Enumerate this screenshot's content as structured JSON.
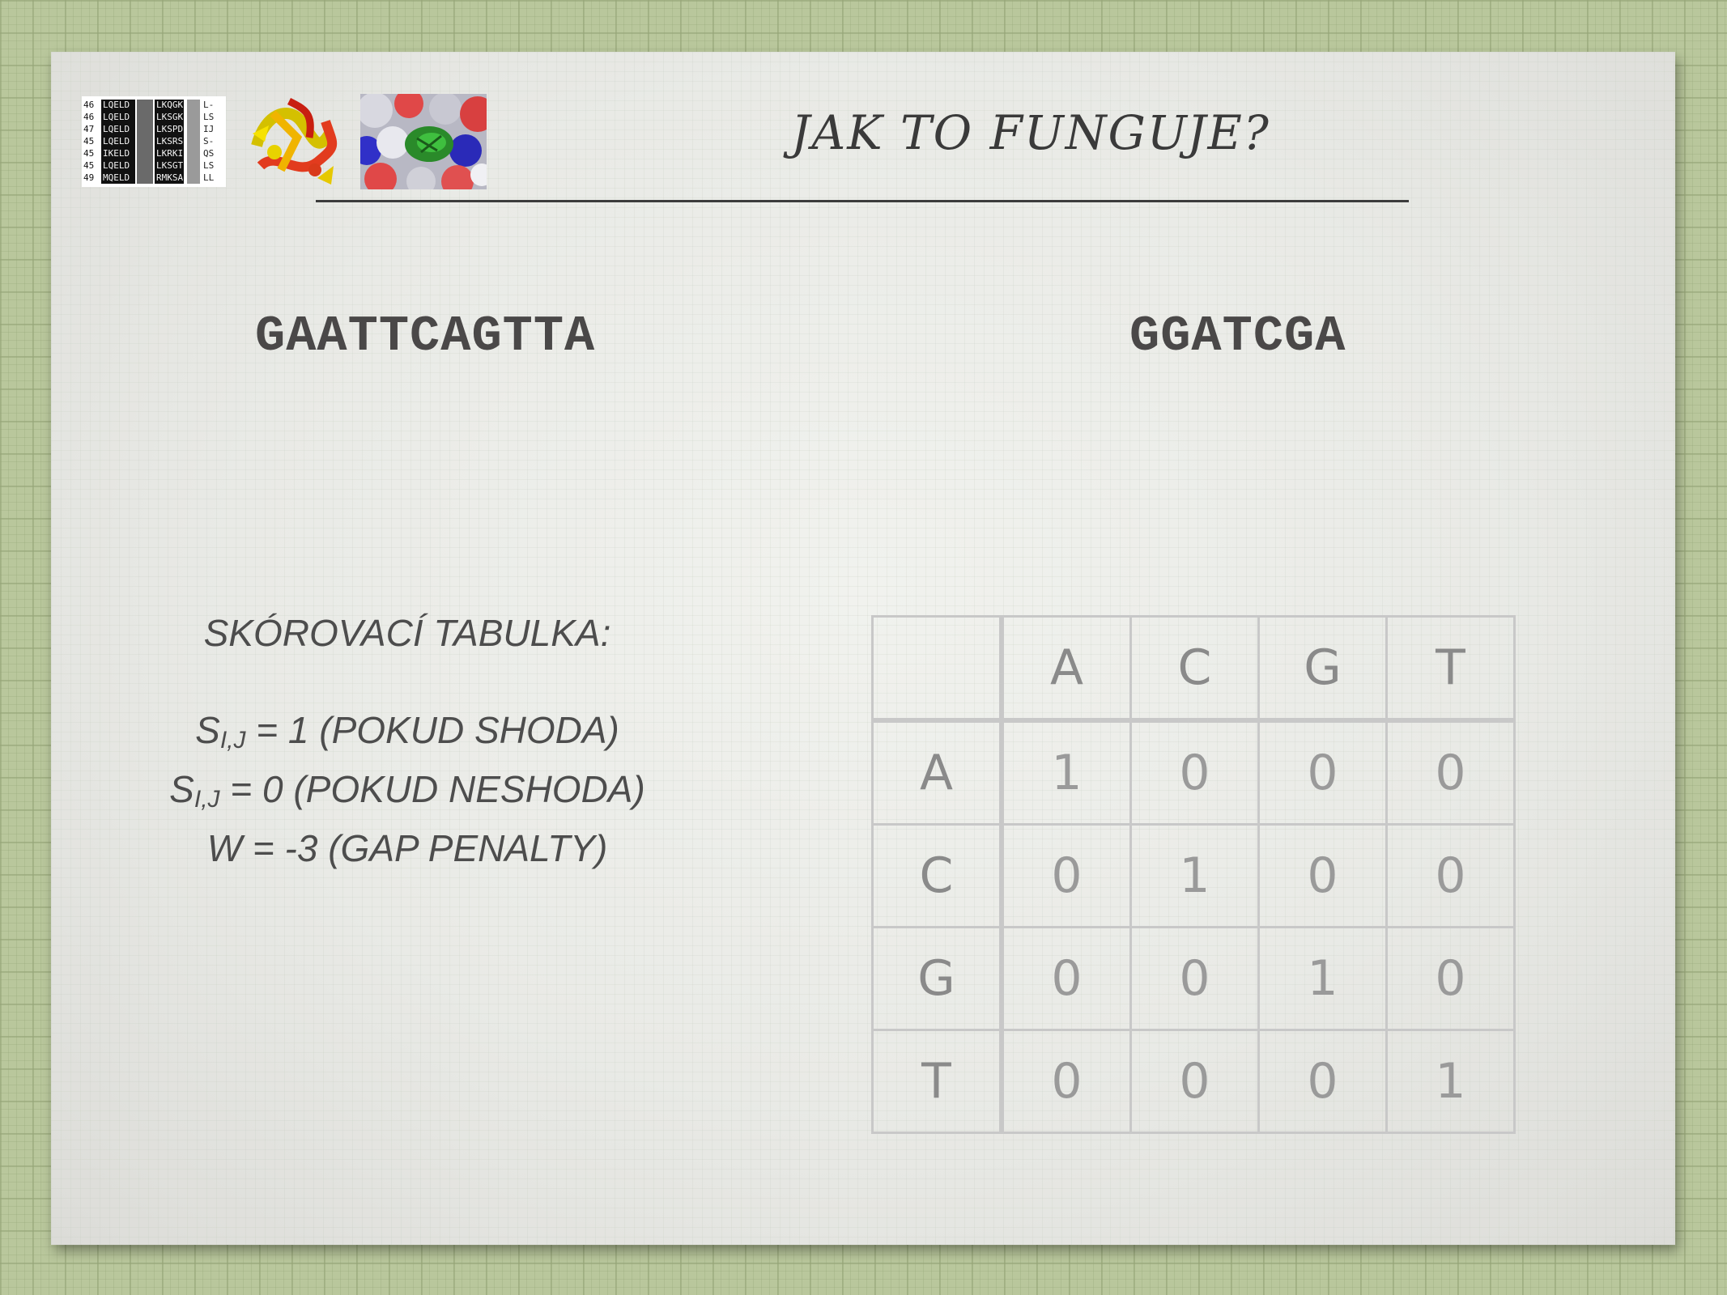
{
  "slide": {
    "title": "JAK TO FUNGUJE?",
    "sequence_1": "GAATTCAGTTA",
    "sequence_2": "GGATCGA"
  },
  "scoring": {
    "heading": "SKÓROVACÍ TABULKA:",
    "lines": [
      {
        "symbol": "S",
        "subscript": "I,J",
        "text": " = 1 (POKUD SHODA)"
      },
      {
        "symbol": "S",
        "subscript": "I,J",
        "text": " = 0 (POKUD NESHODA)"
      },
      {
        "symbol": "",
        "subscript": "",
        "text": "W = -3 (GAP PENALTY)"
      }
    ]
  },
  "matrix": {
    "columns": [
      "A",
      "C",
      "G",
      "T"
    ],
    "rows": [
      {
        "label": "A",
        "values": [
          "1",
          "0",
          "0",
          "0"
        ]
      },
      {
        "label": "C",
        "values": [
          "0",
          "1",
          "0",
          "0"
        ]
      },
      {
        "label": "G",
        "values": [
          "0",
          "0",
          "1",
          "0"
        ]
      },
      {
        "label": "T",
        "values": [
          "0",
          "0",
          "0",
          "1"
        ]
      }
    ]
  },
  "thumbnails": {
    "alignment_icon": "sequence-alignment-icon",
    "ribbon_icon": "protein-ribbon-icon",
    "surface_icon": "protein-surface-icon"
  }
}
